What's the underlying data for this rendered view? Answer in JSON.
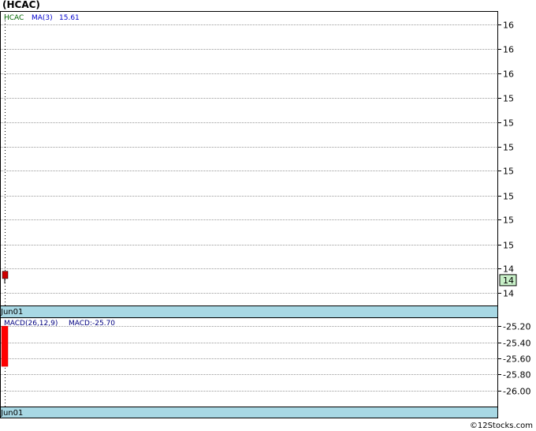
{
  "title": "(HCAC)",
  "credit": "©12Stocks.com",
  "colors": {
    "up": "#cc0000",
    "date_band": "#a8d8e4",
    "grid": "#999999",
    "price_tag": "#c8f0c8",
    "ticker_label": "#006600",
    "ma_label": "#0000cc",
    "macd_label": "#000080"
  },
  "chart_data": [
    {
      "type": "candlestick",
      "panel": "price",
      "legend": {
        "ticker": "HCAC",
        "ma_name": "MA(3)",
        "ma_value": "15.61"
      },
      "ylim": [
        13.7,
        16.1
      ],
      "yticks": [
        {
          "v": 16.0,
          "label": "16"
        },
        {
          "v": 15.8,
          "label": "16"
        },
        {
          "v": 15.6,
          "label": "16"
        },
        {
          "v": 15.4,
          "label": "15"
        },
        {
          "v": 15.2,
          "label": "15"
        },
        {
          "v": 15.0,
          "label": "15"
        },
        {
          "v": 14.8,
          "label": "15"
        },
        {
          "v": 14.6,
          "label": "15"
        },
        {
          "v": 14.4,
          "label": "15"
        },
        {
          "v": 14.2,
          "label": "15"
        },
        {
          "v": 14.0,
          "label": "14"
        },
        {
          "v": 13.8,
          "label": "14"
        },
        {
          "v": 13.6,
          "label": "14"
        }
      ],
      "candles": [
        {
          "date": "Jun01",
          "open": 13.98,
          "high": 13.98,
          "low": 13.88,
          "close": 13.92
        }
      ],
      "last_price_tag": "14",
      "last_price_value": 13.92,
      "x_label": "Jun01"
    },
    {
      "type": "bar",
      "panel": "macd",
      "legend": {
        "name": "MACD(26,12,9)",
        "value_text": "MACD:-25.70"
      },
      "ylim": [
        -26.2,
        -25.1
      ],
      "yticks": [
        {
          "v": -25.2,
          "label": "-25.20"
        },
        {
          "v": -25.4,
          "label": "-25.40"
        },
        {
          "v": -25.6,
          "label": "-25.60"
        },
        {
          "v": -25.8,
          "label": "-25.80"
        },
        {
          "v": -26.0,
          "label": "-26.00"
        }
      ],
      "bars": [
        {
          "date": "Jun01",
          "top": -25.2,
          "bottom": -25.7
        }
      ],
      "x_label": "Jun01"
    }
  ]
}
